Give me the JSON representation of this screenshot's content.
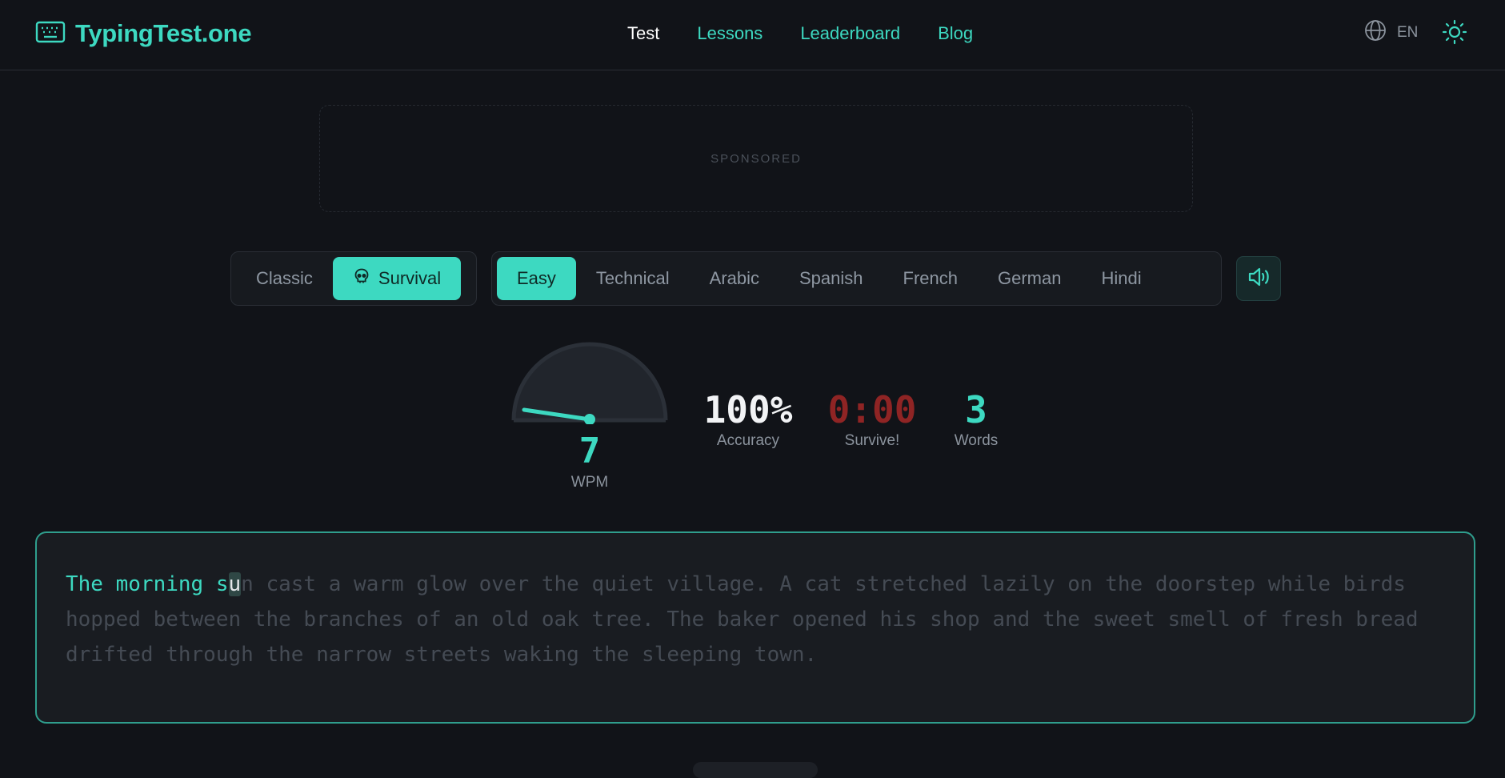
{
  "header": {
    "logo_text": "TypingTest.one",
    "nav": [
      {
        "label": "Test",
        "active": true
      },
      {
        "label": "Lessons",
        "active": false
      },
      {
        "label": "Leaderboard",
        "active": false
      },
      {
        "label": "Blog",
        "active": false
      }
    ],
    "language": "EN"
  },
  "sponsor": {
    "label": "SPONSORED"
  },
  "modes": [
    {
      "label": "Classic",
      "active": false
    },
    {
      "label": "Survival",
      "active": true,
      "icon": "skull-icon"
    }
  ],
  "categories": [
    {
      "label": "Easy",
      "active": true
    },
    {
      "label": "Technical",
      "active": false
    },
    {
      "label": "Arabic",
      "active": false
    },
    {
      "label": "Spanish",
      "active": false
    },
    {
      "label": "French",
      "active": false
    },
    {
      "label": "German",
      "active": false
    },
    {
      "label": "Hindi",
      "active": false
    }
  ],
  "stats": {
    "wpm": "7",
    "wpm_label": "WPM",
    "accuracy": "100%",
    "accuracy_label": "Accuracy",
    "timer": "0:00",
    "timer_label": "Survive!",
    "words": "3",
    "words_label": "Words"
  },
  "typing": {
    "typed": "The morning s",
    "current": "u",
    "remaining": "n cast a warm glow over the quiet village. A cat stretched lazily on the doorstep while birds hopped between the branches of an old oak tree. The baker opened his shop and the sweet smell of fresh bread drifted through the narrow streets waking the sleeping town."
  },
  "colors": {
    "accent": "#3dd9c1",
    "background": "#111318",
    "timer": "#8f2424"
  }
}
